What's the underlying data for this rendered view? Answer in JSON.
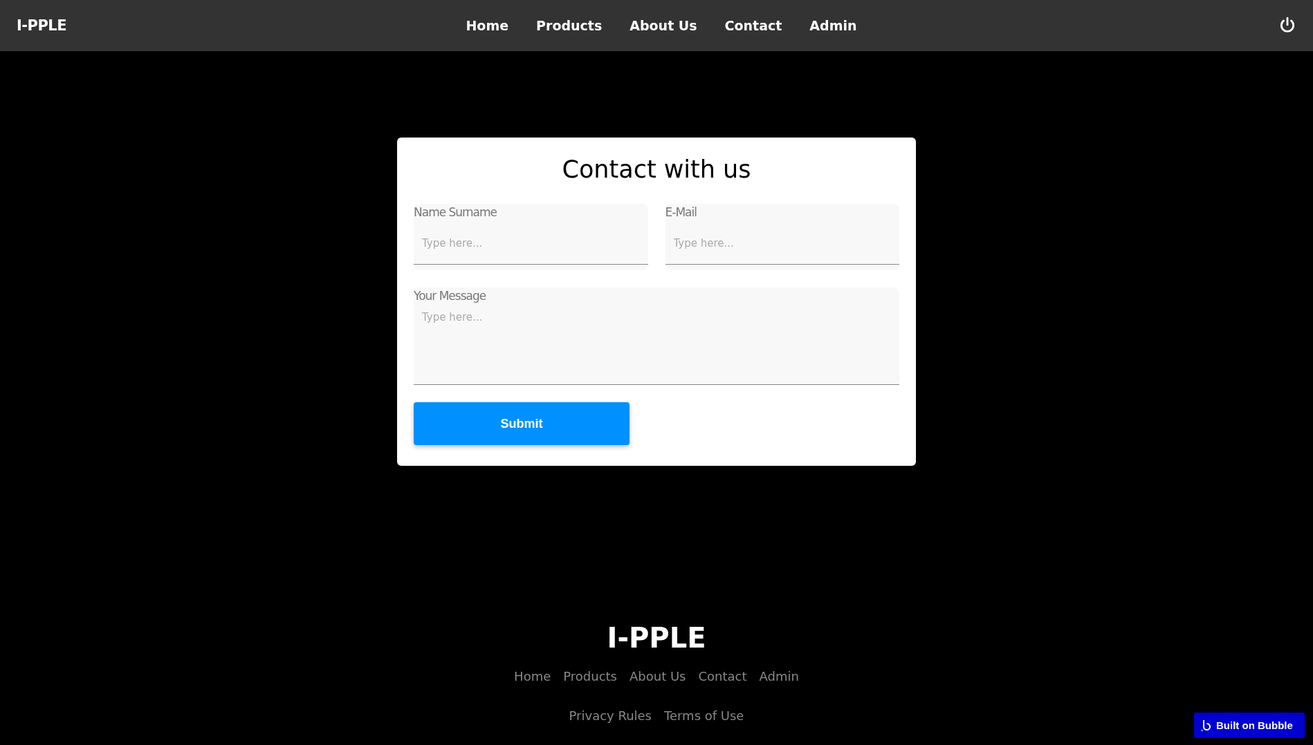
{
  "header": {
    "logo": "I-PPLE",
    "nav": [
      {
        "label": "Home"
      },
      {
        "label": "Products"
      },
      {
        "label": "About Us"
      },
      {
        "label": "Contact"
      },
      {
        "label": "Admin"
      }
    ]
  },
  "form": {
    "title": "Contact with us",
    "fields": [
      {
        "kind": "line",
        "label": "Name Surname",
        "placeholder": "Type here..."
      },
      {
        "kind": "line",
        "label": "E-Mail",
        "placeholder": "Type here..."
      },
      {
        "kind": "multiline",
        "label": "Your Message",
        "placeholder": "Type here..."
      }
    ],
    "submit": "Submit"
  },
  "footer": {
    "logo": "I-PPLE",
    "links": [
      "Home",
      "Products",
      "About Us",
      "Contact",
      "Admin"
    ],
    "legal": [
      "Privacy Rules",
      "Terms of Use"
    ]
  },
  "badge": {
    "label": "Built on Bubble"
  }
}
